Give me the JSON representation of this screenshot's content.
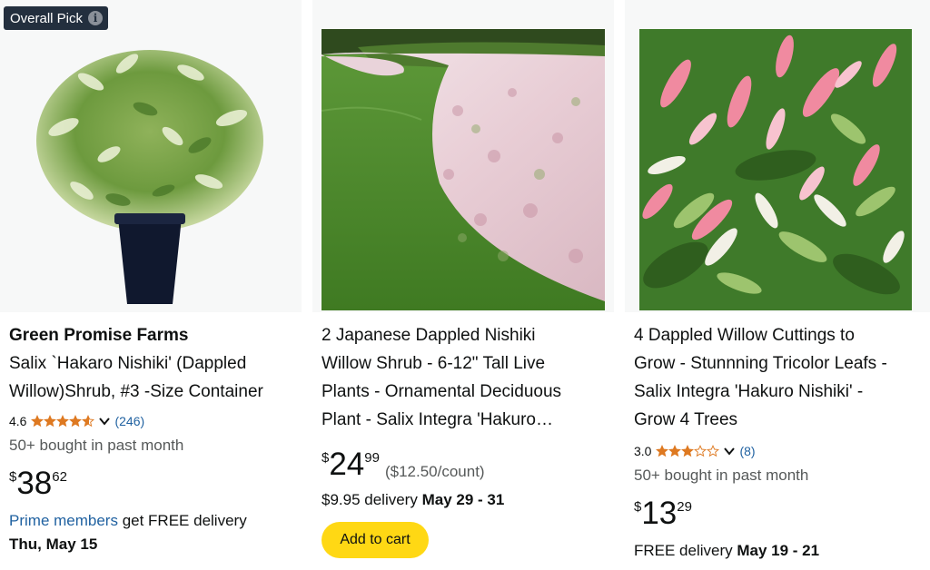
{
  "products": [
    {
      "badge": "Overall Pick",
      "brand": "Green Promise Farms",
      "title_lines": [
        "Salix `Hakaro Nishiki' (Dappled",
        "Willow)Shrub, #3 -Size Container"
      ],
      "rating": "4.6",
      "rating_value": 4.6,
      "rating_count": "(246)",
      "bought": "50+ bought in past month",
      "price_symbol": "$",
      "price_whole": "38",
      "price_fraction": "62",
      "delivery_link": "Prime members",
      "delivery_text": " get FREE delivery",
      "delivery_date": "Thu, May 15"
    },
    {
      "title_lines": [
        "2 Japanese Dappled Nishiki",
        "Willow Shrub - 6-12\" Tall Live",
        "Plants - Ornamental Deciduous",
        "Plant - Salix Integra 'Hakuro…"
      ],
      "price_symbol": "$",
      "price_whole": "24",
      "price_fraction": "99",
      "unit_price": "($12.50/count)",
      "delivery_prefix": "$9.95 delivery ",
      "delivery_date": "May 29 - 31",
      "cart_button": "Add to cart"
    },
    {
      "title_lines": [
        "4 Dappled Willow Cuttings to",
        "Grow - Stunnning Tricolor Leafs -",
        "Salix Integra 'Hakuro Nishiki' -",
        "Grow 4 Trees"
      ],
      "rating": "3.0",
      "rating_value": 3.0,
      "rating_count": "(8)",
      "bought": "50+ bought in past month",
      "price_symbol": "$",
      "price_whole": "13",
      "price_fraction": "29",
      "delivery_prefix": "FREE delivery ",
      "delivery_date": "May 19 - 21"
    }
  ],
  "colors": {
    "star": "#de7921",
    "link": "#2162a1",
    "button": "#ffd814",
    "badge": "#232f3e"
  },
  "icons": [
    "info-icon",
    "star-icon",
    "chevron-down-icon"
  ]
}
